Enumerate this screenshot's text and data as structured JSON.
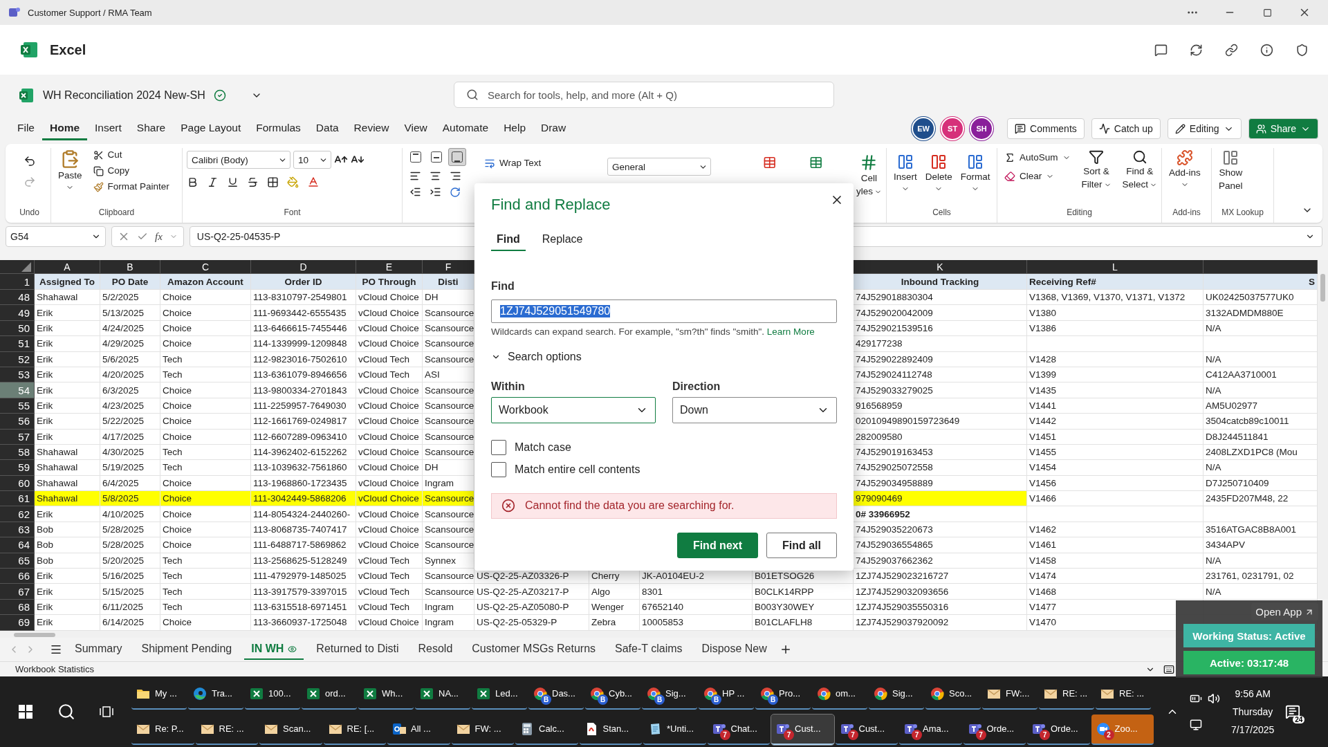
{
  "title_bar": {
    "title": "Customer Support / RMA Team"
  },
  "app_bar": {
    "app_name": "Excel"
  },
  "document": {
    "title": "WH Reconciliation 2024 New-SH",
    "search_placeholder": "Search for tools, help, and more (Alt + Q)"
  },
  "menu_tabs": [
    {
      "label": "File",
      "selected": false
    },
    {
      "label": "Home",
      "selected": true
    },
    {
      "label": "Insert",
      "selected": false
    },
    {
      "label": "Share",
      "selected": false
    },
    {
      "label": "Page Layout",
      "selected": false
    },
    {
      "label": "Formulas",
      "selected": false
    },
    {
      "label": "Data",
      "selected": false
    },
    {
      "label": "Review",
      "selected": false
    },
    {
      "label": "View",
      "selected": false
    },
    {
      "label": "Automate",
      "selected": false
    },
    {
      "label": "Help",
      "selected": false
    },
    {
      "label": "Draw",
      "selected": false
    }
  ],
  "collaborators": [
    {
      "initials": "EW",
      "color": "#1f4e8c"
    },
    {
      "initials": "ST",
      "color": "#d6307a"
    },
    {
      "initials": "SH",
      "color": "#8a1f9a"
    }
  ],
  "header_buttons": {
    "comments": "Comments",
    "catch_up": "Catch up",
    "editing": "Editing",
    "share": "Share"
  },
  "ribbon": {
    "undo_label": "Undo",
    "clipboard": {
      "label": "Clipboard",
      "paste": "Paste",
      "cut": "Cut",
      "copy": "Copy",
      "format_painter": "Format Painter"
    },
    "font": {
      "label": "Font",
      "font_name": "Calibri (Body)",
      "font_size": "10"
    },
    "vertical_align": [
      {
        "selected": false
      },
      {
        "selected": false
      },
      {
        "selected": true
      }
    ],
    "wrap_text": "Wrap Text",
    "number_format": "General",
    "cell_styles": [
      "Cell",
      "yles"
    ],
    "cells": {
      "label": "Cells",
      "buttons": [
        "Insert",
        "Delete",
        "Format"
      ]
    },
    "editing": {
      "label": "Editing",
      "autosum": "AutoSum",
      "clear": "Clear",
      "sort_filter": [
        "Sort &",
        "Filter"
      ],
      "find_select": [
        "Find &",
        "Select"
      ]
    },
    "addins": {
      "label": "Add-ins",
      "button": "Add-ins"
    },
    "mx_lookup": {
      "label": "MX Lookup",
      "button": [
        "Show",
        "Panel"
      ]
    }
  },
  "formula_bar": {
    "name_box": "G54",
    "function_symbol": "fx",
    "formula": "US-Q2-25-04535-P"
  },
  "sheet": {
    "header_row_number": "1",
    "columns": {
      "assigned_to": {
        "letter": "A",
        "title": "Assigned To"
      },
      "po_date": {
        "letter": "B",
        "title": "PO Date"
      },
      "amazon_account": {
        "letter": "C",
        "title": "Amazon Account"
      },
      "order_id": {
        "letter": "D",
        "title": "Order ID"
      },
      "po_through": {
        "letter": "E",
        "title": "PO Through"
      },
      "disti": {
        "letter": "F",
        "title": "Disti"
      },
      "inbound_tracking": {
        "letter": "K",
        "title": "Inbound Tracking"
      },
      "receiving_ref": {
        "letter": "L",
        "title": "Receiving Ref#"
      },
      "column_13": {
        "title": "S"
      }
    },
    "rows": [
      {
        "number": "48",
        "selected": false,
        "highlighted": false,
        "tracking_bold": false,
        "assigned_to": "Shahawal",
        "po_date": "5/2/2025",
        "amazon_account": "Choice",
        "order_id": "113-8310797-2549801",
        "po_through": "vCloud Choice",
        "disti": "DH",
        "inbound_tracking": "74J529018830304",
        "receiving_ref": "V1368, V1369, V1370, V1371, V1372",
        "column_13": "UK02425037577UK0"
      },
      {
        "number": "49",
        "selected": false,
        "highlighted": false,
        "tracking_bold": false,
        "assigned_to": "Erik",
        "po_date": "5/13/2025",
        "amazon_account": "Choice",
        "order_id": "111-9693442-6555435",
        "po_through": "vCloud Choice",
        "disti": "Scansource",
        "inbound_tracking": "74J529020042009",
        "receiving_ref": "V1380",
        "column_13": "3132ADMDM880E"
      },
      {
        "number": "50",
        "selected": false,
        "highlighted": false,
        "tracking_bold": false,
        "assigned_to": "Erik",
        "po_date": "4/24/2025",
        "amazon_account": "Choice",
        "order_id": "113-6466615-7455446",
        "po_through": "vCloud Choice",
        "disti": "Scansource",
        "inbound_tracking": "74J529021539516",
        "receiving_ref": "V1386",
        "column_13": "N/A"
      },
      {
        "number": "51",
        "selected": false,
        "highlighted": false,
        "tracking_bold": false,
        "assigned_to": "Erik",
        "po_date": "4/29/2025",
        "amazon_account": "Choice",
        "order_id": "114-1339999-1209848",
        "po_through": "vCloud Choice",
        "disti": "Scansource",
        "inbound_tracking": "429177238"
      },
      {
        "number": "52",
        "selected": false,
        "highlighted": false,
        "tracking_bold": false,
        "assigned_to": "Erik",
        "po_date": "5/6/2025",
        "amazon_account": "Tech",
        "order_id": "112-9823016-7502610",
        "po_through": "vCloud Tech",
        "disti": "Scansource",
        "inbound_tracking": "74J529022892409",
        "receiving_ref": "V1428",
        "column_13": "N/A"
      },
      {
        "number": "53",
        "selected": false,
        "highlighted": false,
        "tracking_bold": false,
        "assigned_to": "Erik",
        "po_date": "4/20/2025",
        "amazon_account": "Tech",
        "order_id": "113-6361079-8946656",
        "po_through": "vCloud Tech",
        "disti": "ASI",
        "inbound_tracking": "74J529024112748",
        "receiving_ref": "V1399",
        "column_13": "C412AA3710001"
      },
      {
        "number": "54",
        "selected": true,
        "highlighted": false,
        "tracking_bold": false,
        "assigned_to": "Erik",
        "po_date": "6/3/2025",
        "amazon_account": "Choice",
        "order_id": "113-9800334-2701843",
        "po_through": "vCloud Choice",
        "disti": "Scansource",
        "inbound_tracking": "74J529033279025",
        "receiving_ref": "V1435",
        "column_13": "N/A"
      },
      {
        "number": "55",
        "selected": false,
        "highlighted": false,
        "tracking_bold": false,
        "assigned_to": "Erik",
        "po_date": "4/23/2025",
        "amazon_account": "Choice",
        "order_id": "111-2259957-7649030",
        "po_through": "vCloud Choice",
        "disti": "Scansource",
        "inbound_tracking": "916568959",
        "receiving_ref": "V1441",
        "column_13": "AM5U02977"
      },
      {
        "number": "56",
        "selected": false,
        "highlighted": false,
        "tracking_bold": false,
        "assigned_to": "Erik",
        "po_date": "5/22/2025",
        "amazon_account": "Choice",
        "order_id": "112-1661769-0249817",
        "po_through": "vCloud Choice",
        "disti": "Scansource",
        "inbound_tracking": "02010949890159723649",
        "receiving_ref": "V1442",
        "column_13": "3504catcb89c10011"
      },
      {
        "number": "57",
        "selected": false,
        "highlighted": false,
        "tracking_bold": false,
        "assigned_to": "Erik",
        "po_date": "4/17/2025",
        "amazon_account": "Choice",
        "order_id": "112-6607289-0963410",
        "po_through": "vCloud Choice",
        "disti": "Scansource",
        "inbound_tracking": "282009580",
        "receiving_ref": "V1451",
        "column_13": "D8J244511841"
      },
      {
        "number": "58",
        "selected": false,
        "highlighted": false,
        "tracking_bold": false,
        "assigned_to": "Shahawal",
        "po_date": "4/30/2025",
        "amazon_account": "Tech",
        "order_id": "114-3962402-6152262",
        "po_through": "vCloud Choice",
        "disti": "Scansource",
        "inbound_tracking": "74J529019163453",
        "receiving_ref": "V1455",
        "column_13": "2408LZXD1PC8 (Mou"
      },
      {
        "number": "59",
        "selected": false,
        "highlighted": false,
        "tracking_bold": false,
        "assigned_to": "Shahawal",
        "po_date": "5/19/2025",
        "amazon_account": "Tech",
        "order_id": "113-1039632-7561860",
        "po_through": "vCloud Choice",
        "disti": "DH",
        "inbound_tracking": "74J529025072558",
        "receiving_ref": "V1454",
        "column_13": "N/A"
      },
      {
        "number": "60",
        "selected": false,
        "highlighted": false,
        "tracking_bold": false,
        "assigned_to": "Shahawal",
        "po_date": "6/4/2025",
        "amazon_account": "Choice",
        "order_id": "113-1968860-1723435",
        "po_through": "vCloud Choice",
        "disti": "Ingram",
        "inbound_tracking": "74J529034958889",
        "receiving_ref": "V1456",
        "column_13": "D7J250710409"
      },
      {
        "number": "61",
        "selected": false,
        "highlighted": true,
        "tracking_bold": false,
        "assigned_to": "Shahawal",
        "po_date": "5/8/2025",
        "amazon_account": "Choice",
        "order_id": "111-3042449-5868206",
        "po_through": "vCloud Choice",
        "disti": "Scansource",
        "inbound_tracking": "979090469",
        "receiving_ref": "V1466",
        "column_13": "2435FD207M48, 22"
      },
      {
        "number": "62",
        "selected": false,
        "highlighted": false,
        "tracking_bold": true,
        "assigned_to": "Erik",
        "po_date": "4/10/2025",
        "amazon_account": "Choice",
        "order_id": "114-8054324-2440260-",
        "po_through": "vCloud Choice",
        "disti": "Scansource",
        "inbound_tracking": "0# 33966952"
      },
      {
        "number": "63",
        "selected": false,
        "highlighted": false,
        "tracking_bold": false,
        "assigned_to": "Bob",
        "po_date": "5/28/2025",
        "amazon_account": "Choice",
        "order_id": "113-8068735-7407417",
        "po_through": "vCloud Choice",
        "disti": "Scansource",
        "inbound_tracking": "74J529035220673",
        "receiving_ref": "V1462",
        "column_13": "3516ATGAC8B8A001"
      },
      {
        "number": "64",
        "selected": false,
        "highlighted": false,
        "tracking_bold": false,
        "assigned_to": "Bob",
        "po_date": "5/28/2025",
        "amazon_account": "Choice",
        "order_id": "111-6488717-5869862",
        "po_through": "vCloud Choice",
        "disti": "Scansource",
        "inbound_tracking": "74J529036554865",
        "receiving_ref": "V1461",
        "column_13": "3434APV"
      },
      {
        "number": "65",
        "selected": false,
        "highlighted": false,
        "tracking_bold": false,
        "assigned_to": "Bob",
        "po_date": "5/20/2025",
        "amazon_account": "Tech",
        "order_id": "113-2568625-5128249",
        "po_through": "vCloud Tech",
        "disti": "Synnex",
        "inbound_tracking": "74J529037662362",
        "receiving_ref": "V1458",
        "column_13": "N/A"
      },
      {
        "number": "66",
        "selected": false,
        "highlighted": false,
        "tracking_bold": false,
        "assigned_to": "Erik",
        "po_date": "5/16/2025",
        "amazon_account": "Tech",
        "order_id": "111-4792979-1485025",
        "po_through": "vCloud Tech",
        "disti": "Scansource",
        "column_7": "US-Q2-25-AZ03326-P",
        "column_8": "Cherry",
        "column_9": "JK-A0104EU-2",
        "column_10": "B01ETSOG26",
        "inbound_tracking": "1ZJ74J529023216727",
        "receiving_ref": "V1474",
        "column_13": "231761, 0231791, 02"
      },
      {
        "number": "67",
        "selected": false,
        "highlighted": false,
        "tracking_bold": false,
        "assigned_to": "Erik",
        "po_date": "5/15/2025",
        "amazon_account": "Tech",
        "order_id": "113-3917579-3397015",
        "po_through": "vCloud Tech",
        "disti": "Scansource",
        "column_7": "US-Q2-25-AZ03217-P",
        "column_8": "Algo",
        "column_9": "8301",
        "column_10": "B0CLK14RPP",
        "inbound_tracking": "1ZJ74J529032093656",
        "receiving_ref": "V1468",
        "column_13": "N/A"
      },
      {
        "number": "68",
        "selected": false,
        "highlighted": false,
        "tracking_bold": false,
        "assigned_to": "Erik",
        "po_date": "6/11/2025",
        "amazon_account": "Tech",
        "order_id": "113-6315518-6971451",
        "po_through": "vCloud Tech",
        "disti": "Ingram",
        "column_7": "US-Q2-25-AZ05080-P",
        "column_8": "Wenger",
        "column_9": "67652140",
        "column_10": "B003Y30WEY",
        "inbound_tracking": "1ZJ74J529035550316",
        "receiving_ref": "V1477"
      },
      {
        "number": "69",
        "selected": false,
        "highlighted": false,
        "tracking_bold": false,
        "assigned_to": "Erik",
        "po_date": "6/14/2025",
        "amazon_account": "Choice",
        "order_id": "113-3660937-1725048",
        "po_through": "vCloud Choice",
        "disti": "Ingram",
        "column_7": "US-Q2-25-05329-P",
        "column_8": "Zebra",
        "column_9": "10005853",
        "column_10": "B01CLAFLH8",
        "inbound_tracking": "1ZJ74J529037920092",
        "receiving_ref": "V1470"
      }
    ]
  },
  "sheet_tabs": [
    {
      "label": "Summary",
      "selected": false
    },
    {
      "label": "Shipment Pending",
      "selected": false
    },
    {
      "label": "IN WH",
      "selected": true
    },
    {
      "label": "Returned to Disti",
      "selected": false
    },
    {
      "label": "Resold",
      "selected": false
    },
    {
      "label": "Customer MSGs Returns",
      "selected": false
    },
    {
      "label": "Safe-T claims",
      "selected": false
    },
    {
      "label": "Dispose New",
      "selected": false
    }
  ],
  "status_bar": {
    "label": "Workbook Statistics"
  },
  "find_dialog": {
    "title": "Find and Replace",
    "tabs": [
      {
        "label": "Find",
        "selected": true
      },
      {
        "label": "Replace",
        "selected": false
      }
    ],
    "find_label": "Find",
    "find_value": "1ZJ74J529051549780",
    "hint": "Wildcards can expand search. For example, \"sm?th\" finds \"smith\".",
    "hint_link": "Learn More",
    "search_options": {
      "label": "Search options",
      "expanded": true
    },
    "within": {
      "label": "Within",
      "value": "Workbook"
    },
    "direction": {
      "label": "Direction",
      "value": "Down"
    },
    "options": [
      {
        "label": "Match case",
        "checked": false
      },
      {
        "label": "Match entire cell contents",
        "checked": false
      }
    ],
    "error": "Cannot find the data you are searching for.",
    "buttons": {
      "primary": "Find next",
      "secondary": "Find all"
    }
  },
  "presence_widget": {
    "open_app": "Open App",
    "working_status": "Working Status: Active",
    "active_time": "Active: 03:17:48"
  },
  "taskbar": {
    "top_row": [
      {
        "kind": "folder",
        "label": "My ...",
        "selected": false,
        "attention": false
      },
      {
        "kind": "edge",
        "label": "Tra...",
        "selected": false,
        "attention": false
      },
      {
        "kind": "excel",
        "label": "100...",
        "selected": false,
        "attention": false
      },
      {
        "kind": "excel",
        "label": "ord...",
        "selected": false,
        "attention": false
      },
      {
        "kind": "excel",
        "label": "Wh...",
        "selected": false,
        "attention": false
      },
      {
        "kind": "excel",
        "label": "NA...",
        "selected": false,
        "attention": false
      },
      {
        "kind": "excel",
        "label": "Led...",
        "selected": false,
        "attention": false
      },
      {
        "kind": "chrome",
        "label": "Das...",
        "badge": "B",
        "selected": false,
        "attention": false
      },
      {
        "kind": "chrome",
        "label": "Cyb...",
        "badge": "B",
        "selected": false,
        "attention": false
      },
      {
        "kind": "chrome",
        "label": "Sig...",
        "badge": "B",
        "selected": false,
        "attention": false
      },
      {
        "kind": "chrome",
        "label": "HP ...",
        "badge": "B",
        "selected": false,
        "attention": false
      },
      {
        "kind": "chrome",
        "label": "Pro...",
        "badge": "B",
        "selected": false,
        "attention": false
      },
      {
        "kind": "chrome",
        "label": "om...",
        "selected": false,
        "attention": false
      },
      {
        "kind": "chrome",
        "label": "Sig...",
        "selected": false,
        "attention": false
      },
      {
        "kind": "chrome",
        "label": "Sco...",
        "selected": false,
        "attention": false
      },
      {
        "kind": "mail",
        "label": "FW:...",
        "selected": false,
        "attention": false
      },
      {
        "kind": "mail",
        "label": "RE: ...",
        "selected": false,
        "attention": false
      },
      {
        "kind": "mail",
        "label": "RE: ...",
        "selected": false,
        "attention": false
      }
    ],
    "bottom_row": [
      {
        "kind": "mail",
        "label": "Re: P...",
        "selected": false,
        "attention": false
      },
      {
        "kind": "mail",
        "label": "RE: ...",
        "selected": false,
        "attention": false
      },
      {
        "kind": "mail",
        "label": "Scan...",
        "selected": false,
        "attention": false
      },
      {
        "kind": "mail",
        "label": "RE: [...",
        "selected": false,
        "attention": false
      },
      {
        "kind": "outlook",
        "label": "All ...",
        "selected": false,
        "attention": false
      },
      {
        "kind": "mail",
        "label": "FW: ...",
        "selected": false,
        "attention": false
      },
      {
        "kind": "calculator",
        "label": "Calc...",
        "selected": false,
        "attention": false
      },
      {
        "kind": "pdf",
        "label": "Stan...",
        "selected": false,
        "attention": false
      },
      {
        "kind": "notepad",
        "label": "*Unti...",
        "selected": false,
        "attention": false
      },
      {
        "kind": "teams",
        "label": "Chat...",
        "badge": "7",
        "selected": false,
        "attention": false
      },
      {
        "kind": "teams",
        "label": "Cust...",
        "badge": "7",
        "selected": true,
        "attention": false
      },
      {
        "kind": "teams",
        "label": "Cust...",
        "badge": "7",
        "selected": false,
        "attention": false
      },
      {
        "kind": "teams",
        "label": "Ama...",
        "badge": "7",
        "selected": false,
        "attention": false
      },
      {
        "kind": "teams",
        "label": "Orde...",
        "badge": "7",
        "selected": false,
        "attention": false
      },
      {
        "kind": "teams",
        "label": "Orde...",
        "badge": "7",
        "selected": false,
        "attention": false
      },
      {
        "kind": "zoom",
        "label": "Zoo...",
        "badge": "2",
        "selected": false,
        "attention": true
      }
    ],
    "clock": {
      "time": "9:56 AM",
      "day": "Thursday",
      "date": "7/17/2025"
    },
    "notifications": "24"
  }
}
